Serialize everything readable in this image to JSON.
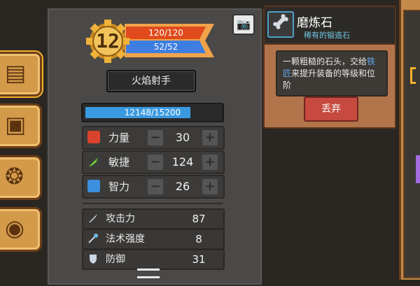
{
  "hero": {
    "level": "12",
    "hp_text": "120/120",
    "mp_text": "52/52",
    "class_name": "火焰射手",
    "xp_text": "12148/15200",
    "xp_fraction": 0.799
  },
  "stats": [
    {
      "label": "力量",
      "value": "30",
      "icon": "fist-icon",
      "color": "#d9432b"
    },
    {
      "label": "敏捷",
      "value": "124",
      "icon": "feather-icon",
      "color": "#6dcf39"
    },
    {
      "label": "智力",
      "value": "26",
      "icon": "book-icon",
      "color": "#3d8fe0"
    }
  ],
  "stat_controls": {
    "minus": "−",
    "plus": "+"
  },
  "attributes": [
    {
      "label": "攻击力",
      "value": "87",
      "icon": "sword-icon"
    },
    {
      "label": "法术强度",
      "value": "8",
      "icon": "wand-icon"
    },
    {
      "label": "防御",
      "value": "31",
      "icon": "shield-icon"
    }
  ],
  "item": {
    "name": "磨炼石",
    "rarity": "稀有的锻造石",
    "desc_part1": "一颗粗糙的石头，交给",
    "desc_highlight": "铁匠",
    "desc_part2": "来提升装备的等级和位阶",
    "discard_label": "丢弃"
  },
  "icons": {
    "camera": "📷",
    "item": "🦴"
  },
  "colors": {
    "hp": "#e04a1d",
    "mp": "#3d7ee0",
    "xp": "#3a9ae0",
    "accent": "#f3b12c"
  }
}
